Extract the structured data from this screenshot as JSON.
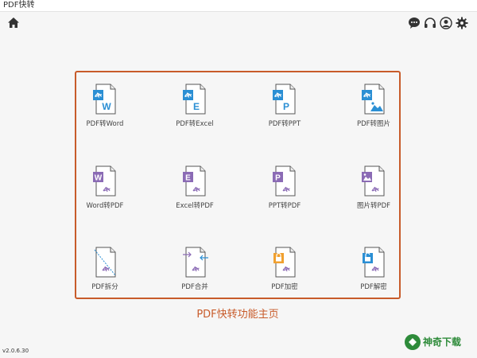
{
  "window": {
    "title": "PDF快转",
    "min": "—",
    "max": "□",
    "close": "✕"
  },
  "toolbar": {
    "home": "home-icon",
    "icons": [
      "chat-icon",
      "headset-icon",
      "user-icon",
      "gear-icon"
    ]
  },
  "tiles": [
    {
      "label": "PDF转Word",
      "letter": "W",
      "kind": "pdf-to",
      "color": "#2b8fd4"
    },
    {
      "label": "PDF转Excel",
      "letter": "E",
      "kind": "pdf-to",
      "color": "#2b8fd4"
    },
    {
      "label": "PDF转PPT",
      "letter": "P",
      "kind": "pdf-to",
      "color": "#2b8fd4"
    },
    {
      "label": "PDF转图片",
      "letter": "img",
      "kind": "pdf-to",
      "color": "#2b8fd4"
    },
    {
      "label": "Word转PDF",
      "letter": "W",
      "kind": "to-pdf",
      "color": "#8b6bb5"
    },
    {
      "label": "Excel转PDF",
      "letter": "E",
      "kind": "to-pdf",
      "color": "#8b6bb5"
    },
    {
      "label": "PPT转PDF",
      "letter": "P",
      "kind": "to-pdf",
      "color": "#8b6bb5"
    },
    {
      "label": "图片转PDF",
      "letter": "img",
      "kind": "to-pdf",
      "color": "#8b6bb5"
    },
    {
      "label": "PDF拆分",
      "letter": "",
      "kind": "split",
      "color": "#8b6bb5"
    },
    {
      "label": "PDF合并",
      "letter": "",
      "kind": "merge",
      "color": "#8b6bb5"
    },
    {
      "label": "PDF加密",
      "letter": "",
      "kind": "lock",
      "color": "#f0a030"
    },
    {
      "label": "PDF解密",
      "letter": "",
      "kind": "unlock",
      "color": "#2b8fd4"
    }
  ],
  "caption": "PDF快转功能主页",
  "version": "v2.0.6.30",
  "watermark": "神奇下载"
}
